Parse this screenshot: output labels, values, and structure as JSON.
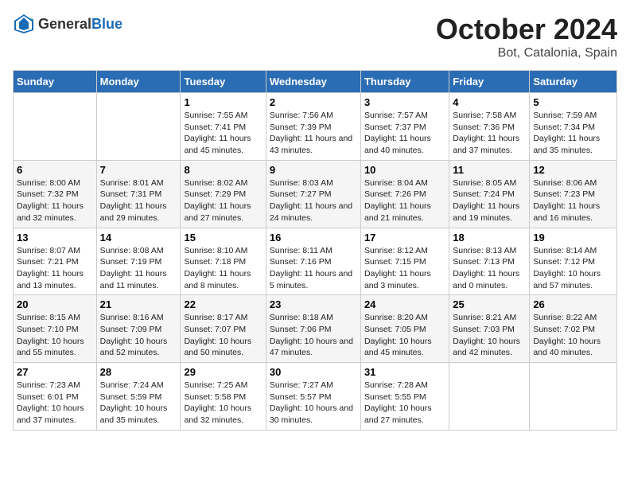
{
  "header": {
    "logo_general": "General",
    "logo_blue": "Blue",
    "title": "October 2024",
    "location": "Bot, Catalonia, Spain"
  },
  "days_of_week": [
    "Sunday",
    "Monday",
    "Tuesday",
    "Wednesday",
    "Thursday",
    "Friday",
    "Saturday"
  ],
  "weeks": [
    [
      {
        "day": "",
        "info": ""
      },
      {
        "day": "",
        "info": ""
      },
      {
        "day": "1",
        "info": "Sunrise: 7:55 AM\nSunset: 7:41 PM\nDaylight: 11 hours and 45 minutes."
      },
      {
        "day": "2",
        "info": "Sunrise: 7:56 AM\nSunset: 7:39 PM\nDaylight: 11 hours and 43 minutes."
      },
      {
        "day": "3",
        "info": "Sunrise: 7:57 AM\nSunset: 7:37 PM\nDaylight: 11 hours and 40 minutes."
      },
      {
        "day": "4",
        "info": "Sunrise: 7:58 AM\nSunset: 7:36 PM\nDaylight: 11 hours and 37 minutes."
      },
      {
        "day": "5",
        "info": "Sunrise: 7:59 AM\nSunset: 7:34 PM\nDaylight: 11 hours and 35 minutes."
      }
    ],
    [
      {
        "day": "6",
        "info": "Sunrise: 8:00 AM\nSunset: 7:32 PM\nDaylight: 11 hours and 32 minutes."
      },
      {
        "day": "7",
        "info": "Sunrise: 8:01 AM\nSunset: 7:31 PM\nDaylight: 11 hours and 29 minutes."
      },
      {
        "day": "8",
        "info": "Sunrise: 8:02 AM\nSunset: 7:29 PM\nDaylight: 11 hours and 27 minutes."
      },
      {
        "day": "9",
        "info": "Sunrise: 8:03 AM\nSunset: 7:27 PM\nDaylight: 11 hours and 24 minutes."
      },
      {
        "day": "10",
        "info": "Sunrise: 8:04 AM\nSunset: 7:26 PM\nDaylight: 11 hours and 21 minutes."
      },
      {
        "day": "11",
        "info": "Sunrise: 8:05 AM\nSunset: 7:24 PM\nDaylight: 11 hours and 19 minutes."
      },
      {
        "day": "12",
        "info": "Sunrise: 8:06 AM\nSunset: 7:23 PM\nDaylight: 11 hours and 16 minutes."
      }
    ],
    [
      {
        "day": "13",
        "info": "Sunrise: 8:07 AM\nSunset: 7:21 PM\nDaylight: 11 hours and 13 minutes."
      },
      {
        "day": "14",
        "info": "Sunrise: 8:08 AM\nSunset: 7:19 PM\nDaylight: 11 hours and 11 minutes."
      },
      {
        "day": "15",
        "info": "Sunrise: 8:10 AM\nSunset: 7:18 PM\nDaylight: 11 hours and 8 minutes."
      },
      {
        "day": "16",
        "info": "Sunrise: 8:11 AM\nSunset: 7:16 PM\nDaylight: 11 hours and 5 minutes."
      },
      {
        "day": "17",
        "info": "Sunrise: 8:12 AM\nSunset: 7:15 PM\nDaylight: 11 hours and 3 minutes."
      },
      {
        "day": "18",
        "info": "Sunrise: 8:13 AM\nSunset: 7:13 PM\nDaylight: 11 hours and 0 minutes."
      },
      {
        "day": "19",
        "info": "Sunrise: 8:14 AM\nSunset: 7:12 PM\nDaylight: 10 hours and 57 minutes."
      }
    ],
    [
      {
        "day": "20",
        "info": "Sunrise: 8:15 AM\nSunset: 7:10 PM\nDaylight: 10 hours and 55 minutes."
      },
      {
        "day": "21",
        "info": "Sunrise: 8:16 AM\nSunset: 7:09 PM\nDaylight: 10 hours and 52 minutes."
      },
      {
        "day": "22",
        "info": "Sunrise: 8:17 AM\nSunset: 7:07 PM\nDaylight: 10 hours and 50 minutes."
      },
      {
        "day": "23",
        "info": "Sunrise: 8:18 AM\nSunset: 7:06 PM\nDaylight: 10 hours and 47 minutes."
      },
      {
        "day": "24",
        "info": "Sunrise: 8:20 AM\nSunset: 7:05 PM\nDaylight: 10 hours and 45 minutes."
      },
      {
        "day": "25",
        "info": "Sunrise: 8:21 AM\nSunset: 7:03 PM\nDaylight: 10 hours and 42 minutes."
      },
      {
        "day": "26",
        "info": "Sunrise: 8:22 AM\nSunset: 7:02 PM\nDaylight: 10 hours and 40 minutes."
      }
    ],
    [
      {
        "day": "27",
        "info": "Sunrise: 7:23 AM\nSunset: 6:01 PM\nDaylight: 10 hours and 37 minutes."
      },
      {
        "day": "28",
        "info": "Sunrise: 7:24 AM\nSunset: 5:59 PM\nDaylight: 10 hours and 35 minutes."
      },
      {
        "day": "29",
        "info": "Sunrise: 7:25 AM\nSunset: 5:58 PM\nDaylight: 10 hours and 32 minutes."
      },
      {
        "day": "30",
        "info": "Sunrise: 7:27 AM\nSunset: 5:57 PM\nDaylight: 10 hours and 30 minutes."
      },
      {
        "day": "31",
        "info": "Sunrise: 7:28 AM\nSunset: 5:55 PM\nDaylight: 10 hours and 27 minutes."
      },
      {
        "day": "",
        "info": ""
      },
      {
        "day": "",
        "info": ""
      }
    ]
  ]
}
